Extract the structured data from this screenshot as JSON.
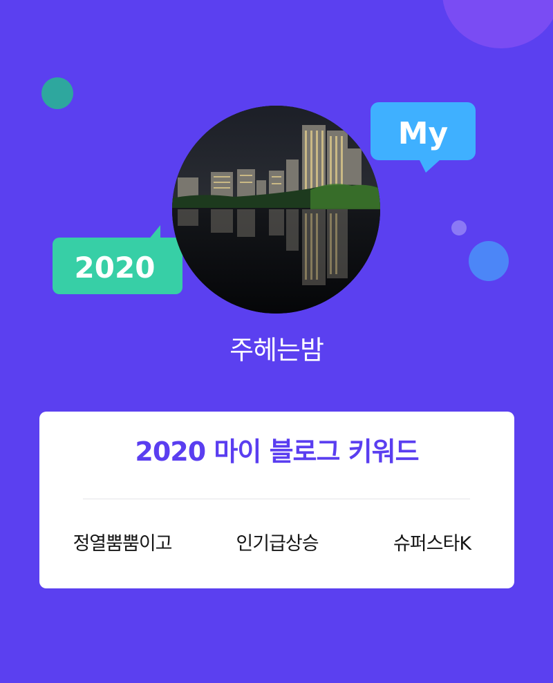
{
  "profile": {
    "username": "주헤는밤",
    "avatar": "night-city-reflection-photo"
  },
  "bubbles": {
    "left_text": "2020",
    "right_text": "My"
  },
  "card": {
    "title": "2020 마이 블로그 키워드",
    "keywords": [
      "정열뿜뿜이고",
      "인기급상승",
      "슈퍼스타K"
    ]
  },
  "colors": {
    "background": "#5b40f0",
    "accent": "#5a3ef0",
    "bubble_green": "#37cfa6",
    "bubble_blue": "#3fb0ff",
    "card": "#ffffff"
  }
}
